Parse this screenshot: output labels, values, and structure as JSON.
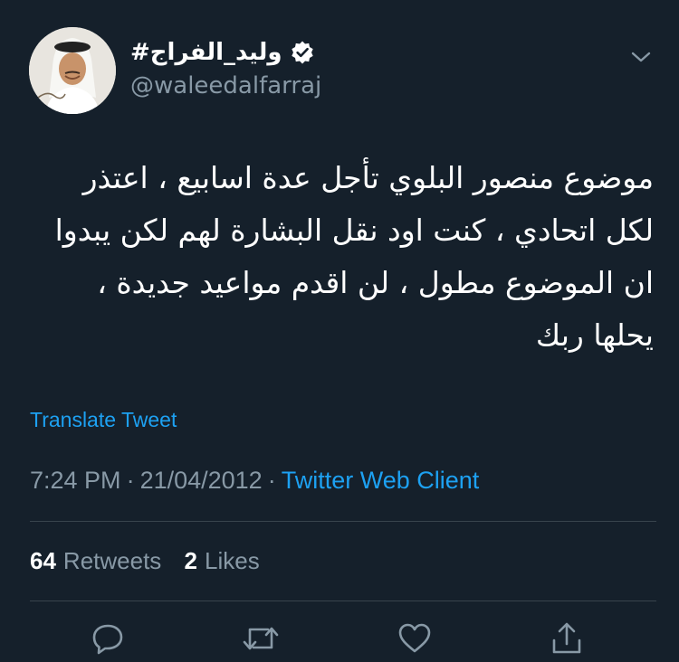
{
  "author": {
    "display_name": "#وليد_الفراج",
    "handle": "@waleedalfarraj",
    "verified": true,
    "avatar_icon": "profile-avatar-icon"
  },
  "tweet": {
    "lines": [
      "موضوع منصور البلوي تأجل عدة اسابيع ، اعتذر",
      "لكل اتحادي ، كنت اود نقل البشارة لهم لكن يبدوا",
      "ان الموضوع مطول ، لن اقدم مواعيد جديدة ،",
      "يحلها ربك"
    ],
    "translate_label": "Translate Tweet"
  },
  "meta": {
    "time": "7:24 PM",
    "separator": "·",
    "date": "21/04/2012",
    "client": "Twitter Web Client"
  },
  "stats": {
    "retweets_count": "64",
    "retweets_label": "Retweets",
    "likes_count": "2",
    "likes_label": "Likes"
  },
  "colors": {
    "background": "#15202b",
    "text": "#ffffff",
    "secondary": "#8899a6",
    "accent": "#1da1f2",
    "divider": "#38444d"
  },
  "icons": {
    "menu": "chevron-down-icon",
    "verified": "verified-badge-icon",
    "reply": "reply-icon",
    "retweet": "retweet-icon",
    "like": "heart-icon",
    "share": "share-icon"
  }
}
